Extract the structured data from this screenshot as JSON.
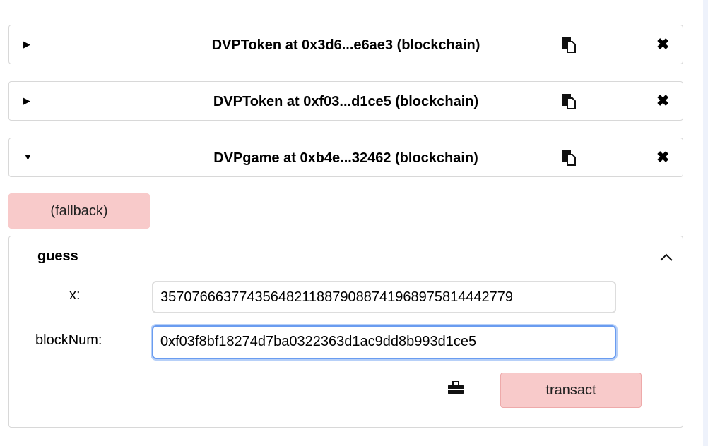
{
  "instances": [
    {
      "title": "DVPToken at 0x3d6...e6ae3 (blockchain)",
      "expanded": false
    },
    {
      "title": "DVPToken at 0xf03...d1ce5 (blockchain)",
      "expanded": false
    },
    {
      "title": "DVPgame at 0xb4e...32462 (blockchain)",
      "expanded": true
    }
  ],
  "icons": {
    "collapsed": "caret-right-icon",
    "expanded": "caret-down-icon",
    "copy": "clipboard-icon",
    "close": "close-icon",
    "collapse": "chevron-up-icon",
    "briefcase": "briefcase-icon"
  },
  "fallback_label": "(fallback)",
  "function": {
    "name": "guess",
    "params": [
      {
        "label": "x:",
        "value": "357076663774356482118879088741968975814442779"
      },
      {
        "label": "blockNum:",
        "value": "0xf03f8bf18274d7ba0322363d1ac9dd8b993d1ce5"
      }
    ],
    "transact_label": "transact"
  },
  "colors": {
    "button": "#f8caca",
    "focus": "#6a9cf0"
  }
}
